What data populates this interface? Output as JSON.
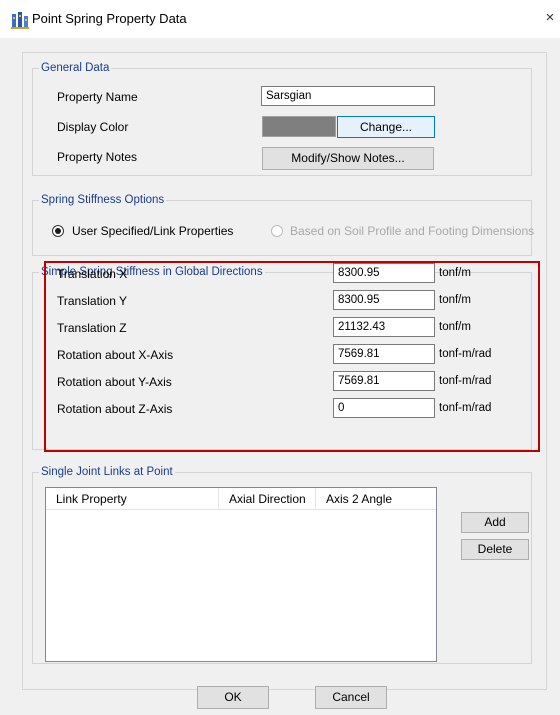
{
  "window": {
    "title": "Point Spring Property Data",
    "close_glyph": "×"
  },
  "general": {
    "legend": "General Data",
    "property_name_label": "Property Name",
    "property_name_value": "Sarsgian",
    "display_color_label": "Display Color",
    "display_color_swatch": "#7f7f7f",
    "change_button": "Change...",
    "property_notes_label": "Property Notes",
    "notes_button": "Modify/Show Notes..."
  },
  "stiffness_options": {
    "legend": "Spring Stiffness Options",
    "option1_label": "User Specified/Link Properties",
    "option1_selected": true,
    "option2_label": "Based on Soil Profile and Footing Dimensions",
    "option2_enabled": false
  },
  "simple_stiffness": {
    "legend": "Simple Spring Stiffness in Global Directions",
    "rows": [
      {
        "label": "Translation  X",
        "value": "8300.95",
        "unit": "tonf/m"
      },
      {
        "label": "Translation  Y",
        "value": "8300.95",
        "unit": "tonf/m"
      },
      {
        "label": "Translation  Z",
        "value": "21132.43",
        "unit": "tonf/m"
      },
      {
        "label": "Rotation about  X-Axis",
        "value": "7569.81",
        "unit": "tonf-m/rad"
      },
      {
        "label": "Rotation about  Y-Axis",
        "value": "7569.81",
        "unit": "tonf-m/rad"
      },
      {
        "label": "Rotation about  Z-Axis",
        "value": "0",
        "unit": "tonf-m/rad"
      }
    ]
  },
  "links": {
    "legend": "Single Joint Links at Point",
    "columns": [
      "Link Property",
      "Axial Direction",
      "Axis 2 Angle"
    ],
    "add_button": "Add",
    "delete_button": "Delete"
  },
  "footer": {
    "ok_button": "OK",
    "cancel_button": "Cancel"
  },
  "colors": {
    "legend_text": "#1a3b8c",
    "highlight_border": "#c00000",
    "dialog_bg": "#f0f0f0"
  }
}
